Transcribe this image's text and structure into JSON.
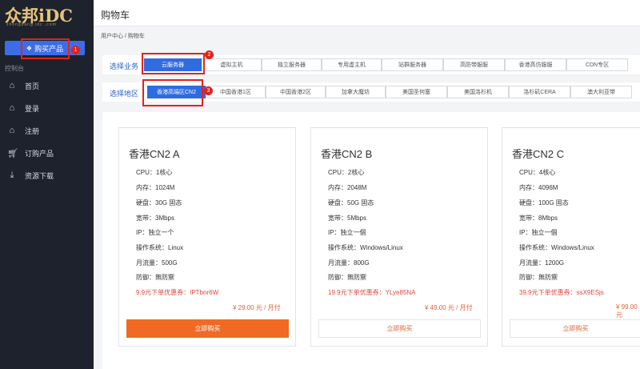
{
  "logo": {
    "text": "众邦iDC",
    "sub": "zhongbang idc .com"
  },
  "sidebar": {
    "buy_button": "购买产品",
    "buy_badge": "1",
    "section_label": "控制台",
    "items": [
      {
        "label": "首页",
        "icon": "home-icon"
      },
      {
        "label": "登录",
        "icon": "login-icon"
      },
      {
        "label": "注册",
        "icon": "register-icon"
      },
      {
        "label": "订购产品",
        "icon": "cart-icon"
      },
      {
        "label": "资源下载",
        "icon": "download-icon"
      }
    ]
  },
  "header": {
    "title": "购物车"
  },
  "breadcrumb": "用户中心 / 购物车",
  "business": {
    "label": "选择业务",
    "options": [
      "云服务器",
      "虚拟主机",
      "独立服务器",
      "专用虚主机",
      "站群服务器",
      "高防带服服",
      "香港高仿服服",
      "CDN专区"
    ],
    "badge": "2"
  },
  "region": {
    "label": "选择地区",
    "options": [
      "香港高端区CN2",
      "中国香港1区",
      "中国香港2区",
      "加拿大魔坊",
      "美国圣何塞",
      "美国洛杉机",
      "洛杉矶CERA",
      "澳大利亚带"
    ],
    "badge": "3"
  },
  "products": [
    {
      "name": "香港CN2 A",
      "specs": [
        "CPU：1核心",
        "内存：1024M",
        "硬盘：30G 固态",
        "宽带：3Mbps",
        "IP：独立一个",
        "操作系统：Linux",
        "月流量：500G",
        "防御：無防禦"
      ],
      "promo": "9.9元下单优惠券：IPTbnr6W",
      "price": "¥ 29.00 元 / 月付",
      "button": "立即购买"
    },
    {
      "name": "香港CN2 B",
      "specs": [
        "CPU：2核心",
        "内存：2048M",
        "硬盘：50G 固态",
        "宽带：5Mbps",
        "IP：独立一個",
        "操作系统：Windows/Linux",
        "月流量：800G",
        "防御：無防禦"
      ],
      "promo": "19.9元下单优惠券：YLye85NA",
      "price": "¥ 49.00 元 / 月付",
      "button": "立即购买"
    },
    {
      "name": "香港CN2 C",
      "specs": [
        "CPU：4核心",
        "内存：4096M",
        "硬盘：100G 固态",
        "宽带：8Mbps",
        "IP：独立一個",
        "操作系统：Windows/Linux",
        "月流量：1200G",
        "防御：無防禦"
      ],
      "promo": "39.9元下单优惠券：ssX9ESjs",
      "price": "¥ 99.00 元",
      "button": "立即购买"
    }
  ],
  "colors": {
    "accent": "#2f6be3",
    "orange": "#f06a25",
    "highlight": "#e2231a",
    "sidebar": "#1e222d"
  }
}
